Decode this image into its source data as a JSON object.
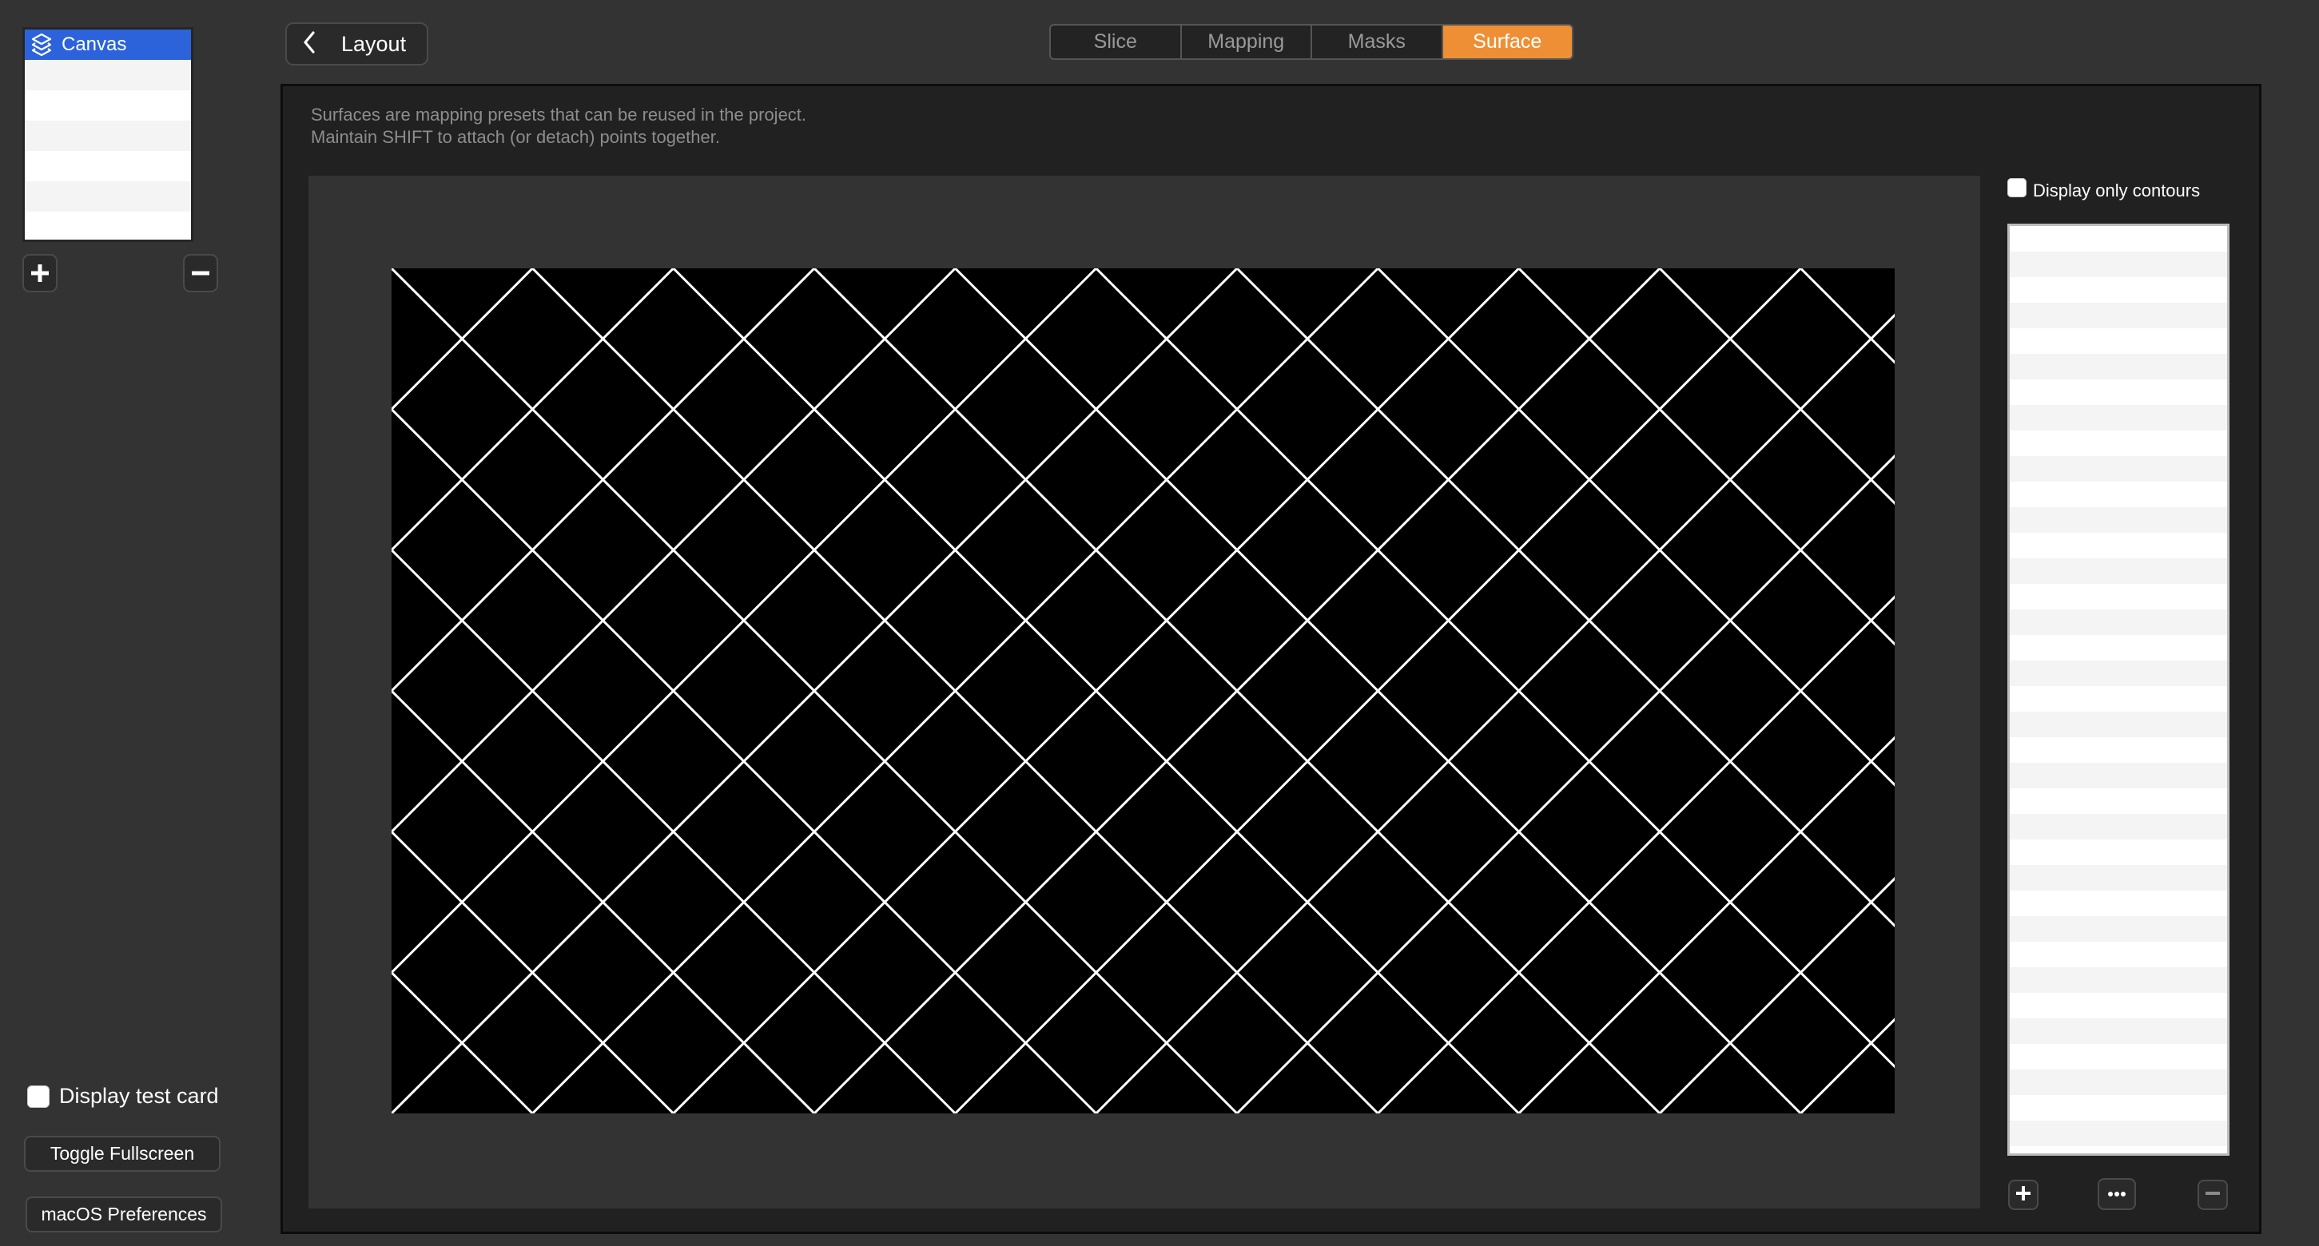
{
  "layers": {
    "items": [
      {
        "label": "Canvas",
        "icon": "layers-icon",
        "selected": true
      }
    ],
    "empty_rows": 6,
    "add_label": "+",
    "remove_label": "−"
  },
  "header": {
    "back_button_label": "Layout",
    "tabs": [
      {
        "label": "Slice",
        "active": false
      },
      {
        "label": "Mapping",
        "active": false
      },
      {
        "label": "Masks",
        "active": false
      },
      {
        "label": "Surface",
        "active": true
      }
    ]
  },
  "surface_panel": {
    "description_line1": "Surfaces are mapping presets that can be reused in the project.",
    "description_line2": "Maintain SHIFT to attach (or detach) points together.",
    "display_only_contours": {
      "label": "Display only contours",
      "checked": false
    },
    "surface_list": {
      "empty_rows": 37
    },
    "canvas_grid": {
      "columns": 10.62,
      "rows": 6,
      "line_color": "#ffffff",
      "background": "#000000"
    },
    "buttons": {
      "add": {
        "icon": "plus-icon",
        "enabled": true
      },
      "more": {
        "icon": "ellipsis-icon",
        "enabled": true
      },
      "remove": {
        "icon": "minus-icon",
        "enabled": false
      }
    }
  },
  "sidebar_bottom": {
    "display_test_card": {
      "label": "Display test card",
      "checked": false
    },
    "toggle_fullscreen_label": "Toggle Fullscreen",
    "macos_preferences_label": "macOS Preferences"
  },
  "colors": {
    "accent_orange": "#ef8f35",
    "selection_blue": "#2d63da",
    "background": "#333333",
    "panel": "#212121"
  }
}
